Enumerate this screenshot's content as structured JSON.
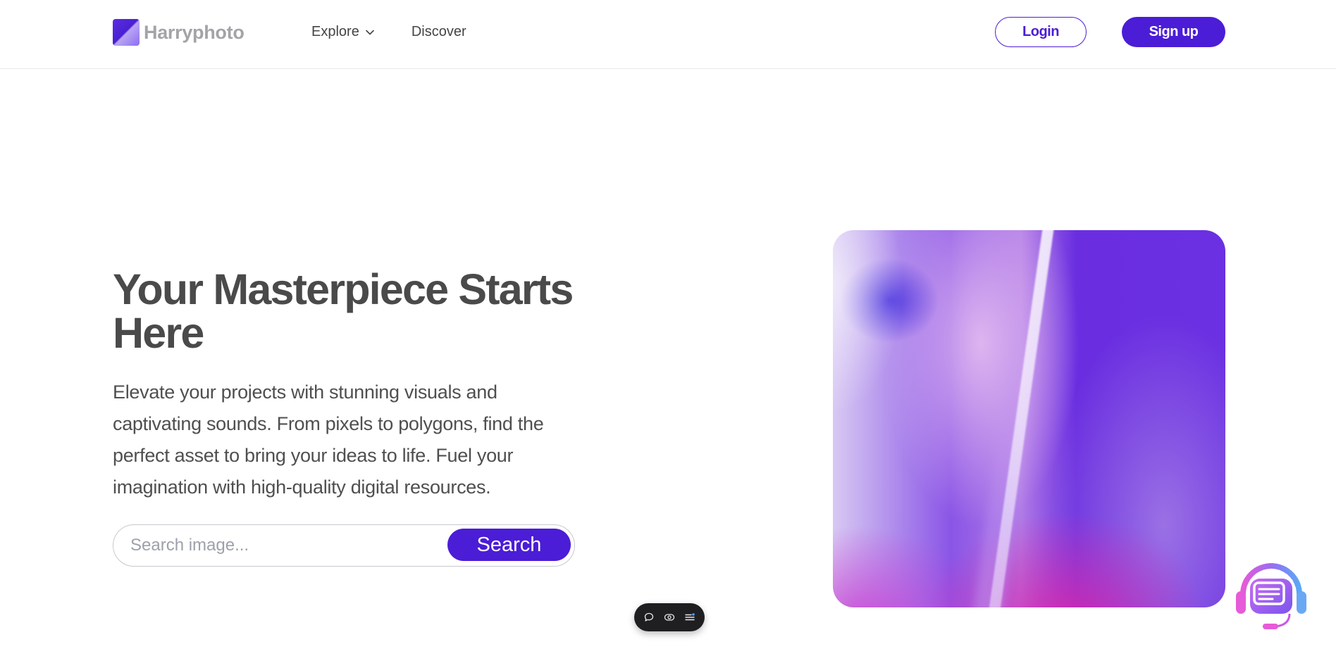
{
  "header": {
    "brand": "Harryphoto",
    "nav": [
      {
        "label": "Explore",
        "has_dropdown": true,
        "icon": "chevron-down-icon"
      },
      {
        "label": "Discover",
        "has_dropdown": false
      }
    ],
    "login_label": "Login",
    "signup_label": "Sign up"
  },
  "hero": {
    "title": "Your Masterpiece Starts Here",
    "description": "Elevate your projects with stunning visuals and captivating sounds. From pixels to polygons, find the perfect asset to bring your ideas to life. Fuel your imagination with high-quality digital resources.",
    "search": {
      "placeholder": "Search image...",
      "value": "",
      "button_label": "Search"
    }
  },
  "floating_toolbar": {
    "icons": [
      "comment-icon",
      "eye-icon",
      "menu-list-icon"
    ]
  },
  "support_widget": {
    "icon": "headset-chat-icon"
  },
  "colors": {
    "primary": "#4b1dd6",
    "text": "#4a4a4a",
    "muted_logo": "#a3a3a8",
    "placeholder": "#9ea0ab"
  }
}
